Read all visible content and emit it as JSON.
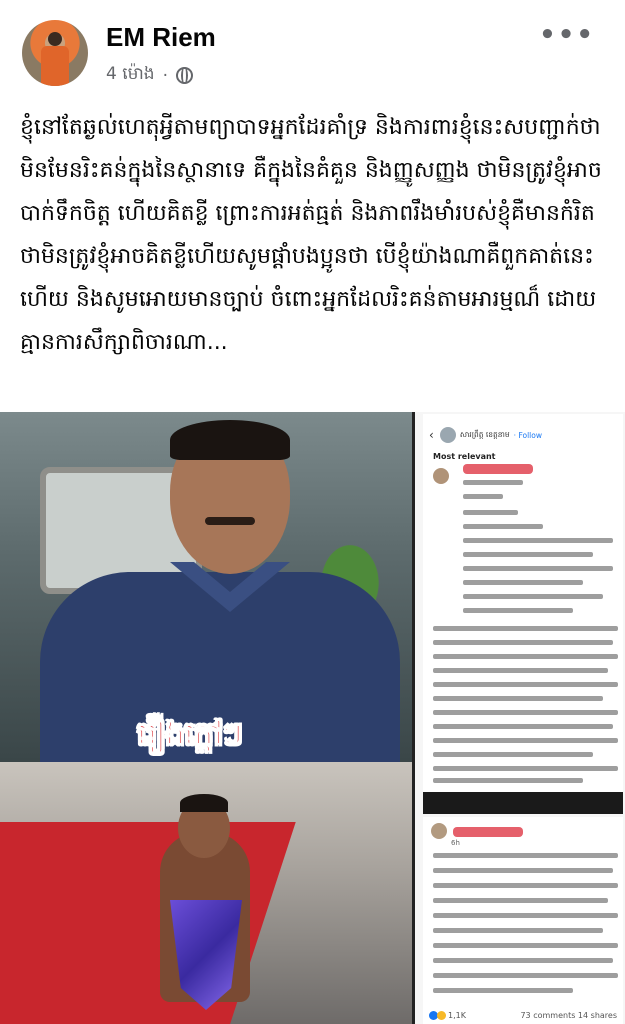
{
  "header": {
    "author": "EM Riem",
    "time": "4 ម៉ោង",
    "separator": "·",
    "privacy_icon": "globe-icon",
    "more_icon": "more-options-icon",
    "more_label": "•••"
  },
  "post": {
    "text": "ខ្ញុំនៅតែឆ្ងល់ហេតុអ្វីតាមព្យាបាទអ្នកដែរគាំទ្រ និងការពារខ្ញុំនេះសបញ្ជាក់ថាមិនមែនរិះគន់ក្នុងនៃស្ថានាទេ គឺក្នុងនៃគំគួន និងញ្ញូសញ្ញង ថាមិនត្រូវខ្ញុំអាចបាក់ទឹកចិត្ត ហើយគិតខ្លី ព្រោះការអត់ធ្មត់ និងភាពរឹងមាំរបស់ខ្ញុំគឺមានកំរិត ថាមិនត្រូវខ្ញុំអាចគិតខ្លីហើយសូមផ្ដាំបងប្អូនថា បើខ្ញុំយ៉ាងណាគឺពួកគាត់នេះ ហើយ និងសូមអោយមានច្បាប់ ចំពោះអ្នកដែលរិះគន់តាមអារម្មណ៏ ដោយគ្មានការសឹក្សាពិចារណា..."
  },
  "media": {
    "caption": "រឿងក្តៅៗ",
    "screenshot1": {
      "page_name": "សារព្រឹត្ត ខេត្តនាម",
      "follow": "· Follow",
      "sort": "Most relevant"
    },
    "screenshot2": {
      "time": "6h",
      "reactions": "1,1K",
      "comments": "73 comments",
      "shares": "14 shares"
    }
  },
  "colors": {
    "link_blue": "#1877f2",
    "meta_gray": "#65676b",
    "redact_red": "#e5606b",
    "caption_red": "#d8262b"
  }
}
